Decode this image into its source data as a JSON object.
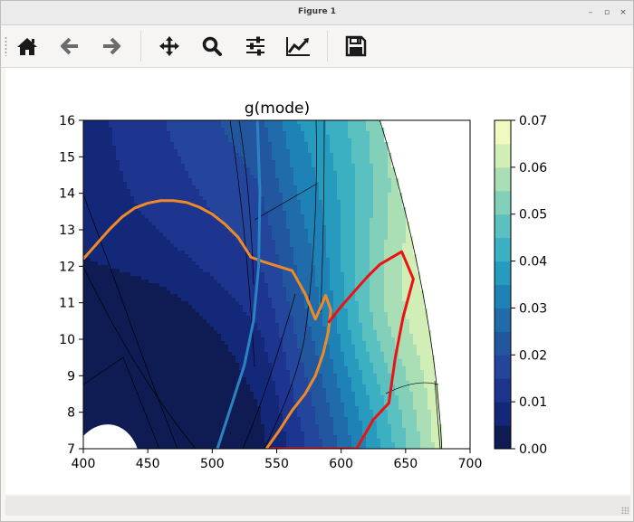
{
  "window": {
    "title": "Figure 1",
    "controls": [
      "–",
      "▫",
      "×"
    ]
  },
  "toolbar": {
    "buttons": [
      {
        "name": "home",
        "icon": "home-icon"
      },
      {
        "name": "back",
        "icon": "arrow-left-icon"
      },
      {
        "name": "forward",
        "icon": "arrow-right-icon"
      },
      {
        "name": "pan",
        "icon": "move-icon"
      },
      {
        "name": "zoom",
        "icon": "magnifier-icon"
      },
      {
        "name": "configure-subplots",
        "icon": "sliders-icon"
      },
      {
        "name": "edit-axis",
        "icon": "line-chart-icon"
      },
      {
        "name": "save",
        "icon": "floppy-disk-icon"
      }
    ]
  },
  "chart_data": {
    "type": "contourf",
    "title": "g(mode)",
    "xlabel": "",
    "ylabel": "",
    "xlim": [
      400,
      700
    ],
    "ylim": [
      7,
      16
    ],
    "xticks": [
      "400",
      "450",
      "500",
      "550",
      "600",
      "650",
      "700"
    ],
    "yticks": [
      "7",
      "8",
      "9",
      "10",
      "11",
      "12",
      "13",
      "14",
      "15",
      "16"
    ],
    "grid": false,
    "colormap": "YlGnBu_r",
    "colorbar": {
      "range": [
        0.0,
        0.07
      ],
      "ticks": [
        "0.00",
        "0.01",
        "0.02",
        "0.03",
        "0.04",
        "0.05",
        "0.06",
        "0.07"
      ],
      "levels": 14,
      "colors": [
        "#0f1c53",
        "#14287a",
        "#1d358e",
        "#23459b",
        "#2257a0",
        "#206ba9",
        "#1f82b6",
        "#279bbd",
        "#3ab0c2",
        "#5bc0c0",
        "#82cfba",
        "#aadfb6",
        "#d0eeb5",
        "#f0f9c0"
      ]
    },
    "overlay_lines": [
      {
        "color": "#f08a24",
        "points": [
          [
            400,
            12.2
          ],
          [
            410,
            12.6
          ],
          [
            420,
            13
          ],
          [
            430,
            13.35
          ],
          [
            440,
            13.6
          ],
          [
            450,
            13.73
          ],
          [
            460,
            13.8
          ],
          [
            470,
            13.8
          ],
          [
            480,
            13.75
          ],
          [
            490,
            13.62
          ],
          [
            500,
            13.43
          ],
          [
            510,
            13.15
          ],
          [
            520,
            12.8
          ],
          [
            530,
            12.25
          ],
          [
            540,
            12.12
          ],
          [
            562,
            11.88
          ],
          [
            572,
            11.25
          ],
          [
            580,
            10.55
          ],
          [
            585,
            10.95
          ],
          [
            588,
            11.2
          ],
          [
            592,
            10.8
          ],
          [
            590,
            10.2
          ],
          [
            586,
            9.6
          ],
          [
            580,
            9.0
          ],
          [
            572,
            8.5
          ],
          [
            562,
            8.05
          ],
          [
            552,
            7.5
          ],
          [
            542,
            7.0
          ]
        ]
      },
      {
        "color": "#ee1111",
        "points": [
          [
            590,
            10.45
          ],
          [
            600,
            10.9
          ],
          [
            610,
            11.3
          ],
          [
            620,
            11.7
          ],
          [
            630,
            12.05
          ],
          [
            647,
            12.4
          ],
          [
            656,
            11.65
          ],
          [
            648,
            10.6
          ],
          [
            642,
            9.5
          ],
          [
            637,
            8.25
          ],
          [
            625,
            7.8
          ],
          [
            612,
            7.0
          ],
          [
            545,
            7.0
          ]
        ]
      },
      {
        "color": "#2a83c2",
        "points": [
          [
            535,
            16.0
          ],
          [
            537,
            14.0
          ],
          [
            536,
            12.0
          ],
          [
            532,
            10.5
          ],
          [
            525,
            9.3
          ],
          [
            515,
            8.2
          ],
          [
            504,
            7.0
          ]
        ]
      }
    ]
  }
}
